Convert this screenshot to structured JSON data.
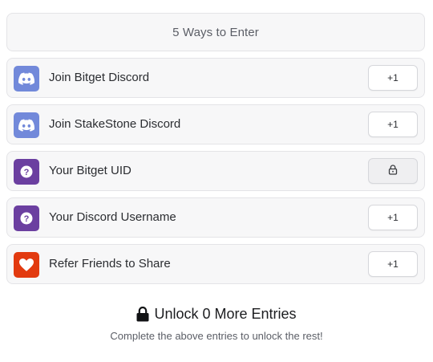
{
  "header": {
    "title": "5 Ways to Enter"
  },
  "entries": [
    {
      "label": "Join Bitget Discord",
      "action": "+1",
      "icon": "discord-icon",
      "icon_color": "#7289da",
      "locked": false
    },
    {
      "label": "Join StakeStone Discord",
      "action": "+1",
      "icon": "discord-icon",
      "icon_color": "#7289da",
      "locked": false
    },
    {
      "label": "Your Bitget UID",
      "action": "",
      "icon": "question-icon",
      "icon_color": "#6b3fa0",
      "locked": true
    },
    {
      "label": "Your Discord Username",
      "action": "+1",
      "icon": "question-icon",
      "icon_color": "#6b3fa0",
      "locked": false
    },
    {
      "label": "Refer Friends to Share",
      "action": "+1",
      "icon": "heart-icon",
      "icon_color": "#e23a0f",
      "locked": false
    }
  ],
  "footer": {
    "title": "Unlock 0 More Entries",
    "subtitle": "Complete the above entries to unlock the rest!"
  }
}
